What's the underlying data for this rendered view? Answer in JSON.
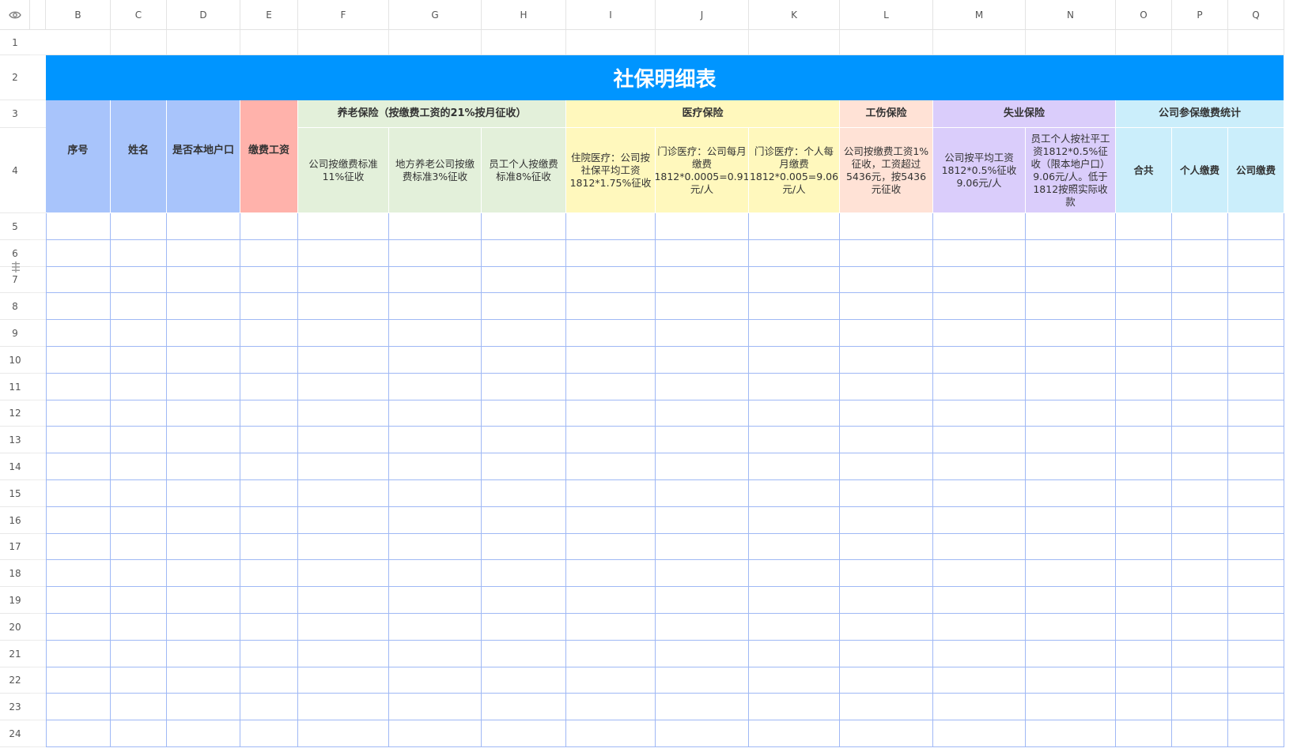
{
  "column_headers": [
    "B",
    "C",
    "D",
    "E",
    "F",
    "G",
    "H",
    "I",
    "J",
    "K",
    "L",
    "M",
    "N",
    "O",
    "P",
    "Q"
  ],
  "row_numbers": [
    "1",
    "2",
    "3",
    "4",
    "5",
    "6",
    "7",
    "8",
    "9",
    "10",
    "11",
    "12",
    "13",
    "14",
    "15",
    "16",
    "17",
    "18",
    "19",
    "20",
    "21",
    "22",
    "23",
    "24"
  ],
  "icons": {
    "corner": "eye-icon",
    "row_handle": "drag-handle-icon"
  },
  "colors": {
    "title_bg": "#0095ff",
    "basic_bg": "#a8c4fb",
    "wage_bg": "#ffb2ab",
    "pension_bg": "#e3f0da",
    "medical_bg": "#fff8bd",
    "injury_bg": "#ffe2d6",
    "unemployment_bg": "#dacdfb",
    "stats_bg": "#cbeefb",
    "grid_line": "#9fb8f5"
  },
  "sheet": {
    "title": "社保明细表",
    "basic_headers": [
      "序号",
      "姓名",
      "是否本地户口"
    ],
    "wage_header": "缴费工资",
    "groups": {
      "pension": "养老保险（按缴费工资的21%按月征收）",
      "medical": "医疗保险",
      "injury": "工伤保险",
      "unemployment": "失业保险",
      "stats": "公司参保缴费统计"
    },
    "subheaders": {
      "F": "公司按缴费标准11%征收",
      "G": "地方养老公司按缴费标准3%征收",
      "H": "员工个人按缴费标准8%征收",
      "I": "住院医疗：公司按社保平均工资1812*1.75%征收",
      "J": "门诊医疗：公司每月缴费1812*0.0005=0.91元/人",
      "K": "门诊医疗：个人每月缴费1812*0.005=9.06元/人",
      "L": "公司按缴费工资1%征收，工资超过5436元，按5436元征收",
      "M": "公司按平均工资1812*0.5%征收9.06元/人",
      "N": "员工个人按社平工资1812*0.5%征收（限本地户口）9.06元/人。低于1812按照实际收款",
      "O": "合共",
      "P": "个人缴费",
      "Q": "公司缴费"
    }
  }
}
